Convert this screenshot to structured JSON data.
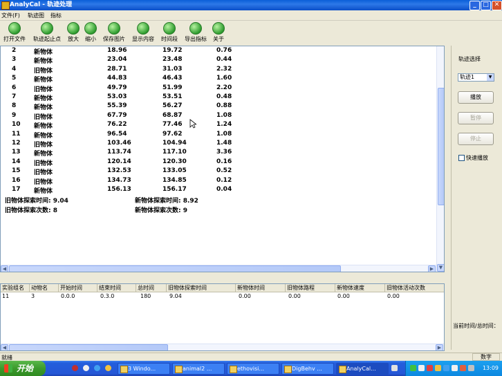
{
  "window": {
    "title": "AnalyCal - 轨迹处理",
    "buttons": [
      "_",
      "□",
      "✕"
    ]
  },
  "menu": [
    "文件(F)",
    "轨迹图",
    "指标"
  ],
  "toolbar": [
    "打开文件",
    "轨迹起止点",
    "放大",
    "缩小",
    "保存图片",
    "显示内容",
    "时间段",
    "导出指标",
    "关于"
  ],
  "text_rows": [
    {
      "n": "2",
      "obj": "新物体",
      "t1": "18.96",
      "t2": "19.72",
      "d": "0.76"
    },
    {
      "n": "3",
      "obj": "新物体",
      "t1": "23.04",
      "t2": "23.48",
      "d": "0.44"
    },
    {
      "n": "4",
      "obj": "旧物体",
      "t1": "28.71",
      "t2": "31.03",
      "d": "2.32"
    },
    {
      "n": "5",
      "obj": "新物体",
      "t1": "44.83",
      "t2": "46.43",
      "d": "1.60"
    },
    {
      "n": "6",
      "obj": "旧物体",
      "t1": "49.79",
      "t2": "51.99",
      "d": "2.20"
    },
    {
      "n": "7",
      "obj": "新物体",
      "t1": "53.03",
      "t2": "53.51",
      "d": "0.48"
    },
    {
      "n": "8",
      "obj": "新物体",
      "t1": "55.39",
      "t2": "56.27",
      "d": "0.88"
    },
    {
      "n": "9",
      "obj": "旧物体",
      "t1": "67.79",
      "t2": "68.87",
      "d": "1.08"
    },
    {
      "n": "10",
      "obj": "新物体",
      "t1": "76.22",
      "t2": "77.46",
      "d": "1.24"
    },
    {
      "n": "11",
      "obj": "新物体",
      "t1": "96.54",
      "t2": "97.62",
      "d": "1.08"
    },
    {
      "n": "12",
      "obj": "旧物体",
      "t1": "103.46",
      "t2": "104.94",
      "d": "1.48"
    },
    {
      "n": "13",
      "obj": "新物体",
      "t1": "113.74",
      "t2": "117.10",
      "d": "3.36"
    },
    {
      "n": "14",
      "obj": "旧物体",
      "t1": "120.14",
      "t2": "120.30",
      "d": "0.16"
    },
    {
      "n": "15",
      "obj": "旧物体",
      "t1": "132.53",
      "t2": "133.05",
      "d": "0.52"
    },
    {
      "n": "16",
      "obj": "旧物体",
      "t1": "134.73",
      "t2": "134.85",
      "d": "0.12"
    },
    {
      "n": "17",
      "obj": "新物体",
      "t1": "156.13",
      "t2": "156.17",
      "d": "0.04"
    }
  ],
  "summary": {
    "old_time": "旧物体探索时间: 9.04",
    "new_time": "新物体探索时间: 8.92",
    "old_count": "旧物体探索次数: 8",
    "new_count": "新物体探索次数: 9"
  },
  "right_panel": {
    "label": "轨迹选择",
    "combo_value": "轨迹1",
    "play": "播放",
    "pause": "暂停",
    "stop": "停止",
    "fast_play": "快速播放",
    "time_label": "当前时间/总时间："
  },
  "table": {
    "headers": [
      "实验组名",
      "动物名",
      "开始时间",
      "结束时间",
      "总时间",
      "旧物体探索时间",
      "新物体时间",
      "旧物体路程",
      "新物体速度",
      "旧物体活动次数"
    ],
    "row": [
      "11",
      "3",
      "0.0.0",
      "0.3.0",
      "180",
      "9.04",
      "0.00",
      "0.00",
      "0.00",
      "0.00"
    ]
  },
  "status": {
    "left": "就绪",
    "right": "数字"
  },
  "taskbar": {
    "start": "开始",
    "items": [
      "3 Windo...",
      "animal2 ...",
      "ethovisi...",
      "DigBehv ...",
      "AnalyCal..."
    ],
    "clock": "13:09"
  }
}
